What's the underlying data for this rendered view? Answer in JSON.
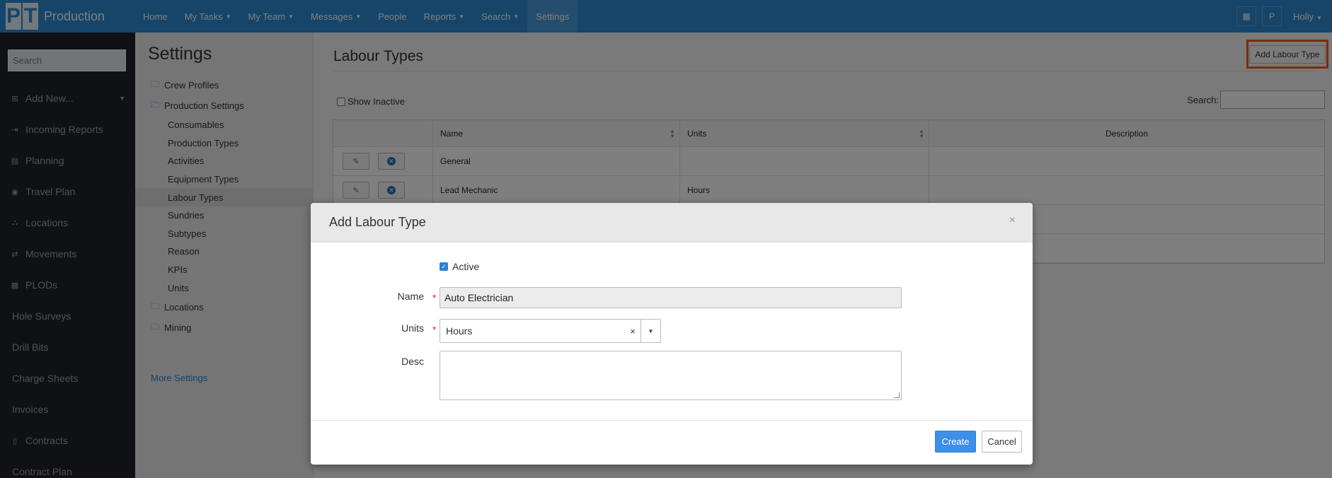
{
  "app": {
    "brand_letters": [
      "P",
      "T"
    ],
    "brand_name": "Production"
  },
  "nav": [
    {
      "label": "Home",
      "caret": false
    },
    {
      "label": "My Tasks",
      "caret": true
    },
    {
      "label": "My Team",
      "caret": true
    },
    {
      "label": "Messages",
      "caret": true
    },
    {
      "label": "People",
      "caret": false
    },
    {
      "label": "Reports",
      "caret": true
    },
    {
      "label": "Search",
      "caret": true
    },
    {
      "label": "Settings",
      "caret": false,
      "active": true
    }
  ],
  "top_right": {
    "profile_initial": "P",
    "user": "Holly"
  },
  "sidebar": {
    "search_placeholder": "Search",
    "items": [
      {
        "label": "Add New...",
        "icon": "plus-square-icon",
        "glyph": "⊞"
      },
      {
        "label": "Incoming Reports",
        "icon": "sign-in-icon",
        "glyph": "⇥"
      },
      {
        "label": "Planning",
        "icon": "chart-icon",
        "glyph": "▤"
      },
      {
        "label": "Travel Plan",
        "icon": "play-circle-icon",
        "glyph": "◉"
      },
      {
        "label": "Locations",
        "icon": "sitemap-icon",
        "glyph": "⛬"
      },
      {
        "label": "Movements",
        "icon": "exchange-icon",
        "glyph": "⇄"
      },
      {
        "label": "PLODs",
        "icon": "table-icon",
        "glyph": "▦"
      },
      {
        "label": "Hole Surveys"
      },
      {
        "label": "Drill Bits"
      },
      {
        "label": "Charge Sheets"
      },
      {
        "label": "Invoices"
      },
      {
        "label": "Contracts",
        "icon": "square-icon",
        "glyph": "▯"
      },
      {
        "label": "Contract Plan"
      }
    ]
  },
  "settings": {
    "title": "Settings",
    "tree": [
      {
        "label": "Crew Profiles",
        "icon": "folder-icon"
      },
      {
        "label": "Production Settings",
        "icon": "folder-open-icon"
      }
    ],
    "sub": [
      "Consumables",
      "Production Types",
      "Activities",
      "Equipment Types",
      "Labour Types",
      "Sundries",
      "Subtypes",
      "Reason",
      "KPIs",
      "Units"
    ],
    "tree_after": [
      {
        "label": "Locations",
        "icon": "folder-icon"
      },
      {
        "label": "Mining",
        "icon": "folder-icon"
      }
    ],
    "more": "More Settings"
  },
  "main": {
    "title": "Labour Types",
    "add_button": "Add Labour Type",
    "show_inactive": "Show Inactive",
    "search_label": "Search:",
    "columns": [
      "Name",
      "Units",
      "Description"
    ],
    "rows": [
      {
        "name": "General",
        "units": "",
        "description": ""
      },
      {
        "name": "Lead Mechanic",
        "units": "Hours",
        "description": ""
      },
      {
        "name": "",
        "units": "",
        "description": ""
      },
      {
        "name": "",
        "units": "",
        "description": ""
      }
    ]
  },
  "modal": {
    "title": "Add Labour Type",
    "close": "×",
    "active_label": "Active",
    "name_label": "Name",
    "name_value": "Auto Electrician",
    "units_label": "Units",
    "units_value": "Hours",
    "desc_label": "Desc",
    "desc_value": "",
    "create": "Create",
    "cancel": "Cancel"
  }
}
